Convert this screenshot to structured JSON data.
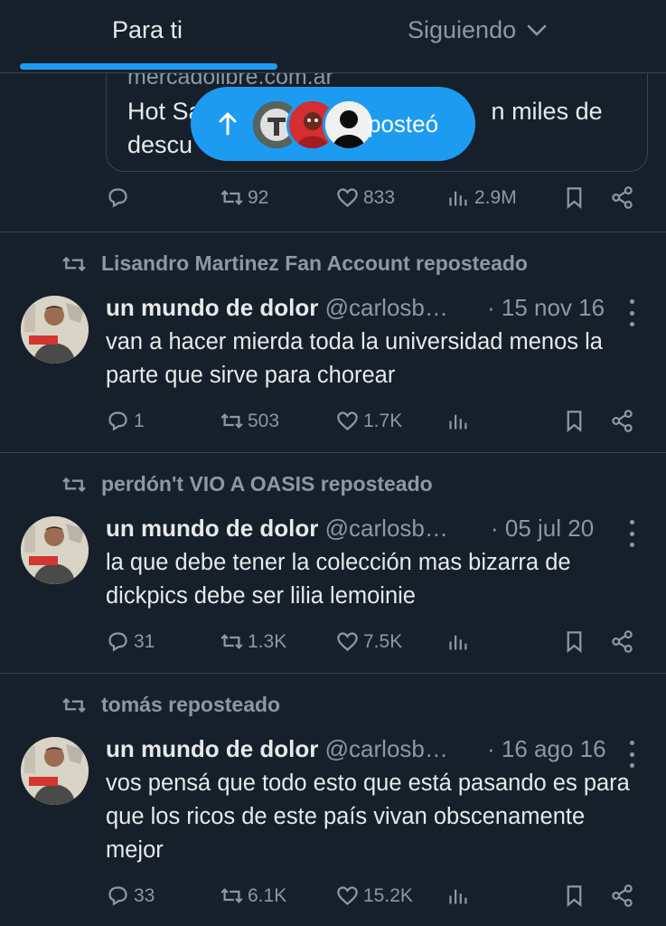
{
  "tabs": {
    "for_you": "Para ti",
    "following": "Siguiendo"
  },
  "new_posts_pill": {
    "label": "posteó"
  },
  "top_card": {
    "domain": "mercadolibre.com.ar",
    "title_line1": "Hot Sa",
    "title_line1_end": "n miles de",
    "title_line2": "descu",
    "stats": {
      "replies": "",
      "reposts": "92",
      "likes": "833",
      "views": "2.9M"
    }
  },
  "tweets": [
    {
      "reposted_by": "Lisandro Martinez Fan Account reposteado",
      "name": "un mundo de dolor",
      "handle": "@carlosb…",
      "date": "· 15 nov 16",
      "text": "van a hacer mierda toda la universidad menos la parte que sirve para chorear",
      "stats": {
        "replies": "1",
        "reposts": "503",
        "likes": "1.7K",
        "views": ""
      }
    },
    {
      "reposted_by": "perdón't VIO A OASIS reposteado",
      "name": "un mundo de dolor",
      "handle": "@carlosb…",
      "date": "· 05 jul 20",
      "text": "la que debe tener la colección mas bizarra de dickpics debe ser lilia lemoinie",
      "stats": {
        "replies": "31",
        "reposts": "1.3K",
        "likes": "7.5K",
        "views": ""
      }
    },
    {
      "reposted_by": "tomás reposteado",
      "name": "un mundo de dolor",
      "handle": "@carlosb…",
      "date": "· 16 ago 16",
      "text": "vos pensá que todo esto que está pasando es para que los ricos de este país vivan obscenamente mejor",
      "stats": {
        "replies": "33",
        "reposts": "6.1K",
        "likes": "15.2K",
        "views": ""
      }
    }
  ],
  "colors": {
    "background": "#15202b",
    "accent": "#1d9bf0",
    "text": "#e7e9ea",
    "muted": "#8b98a5",
    "border": "#38444d"
  }
}
